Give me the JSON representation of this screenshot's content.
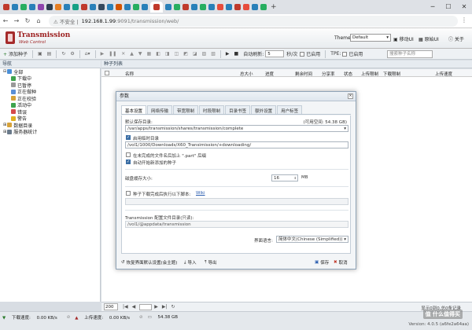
{
  "browser": {
    "warning": "不安全",
    "url_host": "192.168.1.99",
    "url_path": ":9091/transmission/web/"
  },
  "app": {
    "title": "Transmission",
    "subtitle": "Web Control",
    "theme_label": "Theme",
    "theme_value": "Default",
    "mobile_ui": "移动UI",
    "original_ui": "原始UI",
    "about": "关于"
  },
  "toolbar": {
    "add_torrent": "添加种子",
    "speed_limit_label": "自动刷新:",
    "speed_value": "5",
    "seconds": "秒/次",
    "enabled1": "已启用",
    "tpe": "TPE:",
    "enabled2": "已启用",
    "search_placeholder": "搜索种子名称"
  },
  "sidebar": {
    "title": "导航",
    "items": [
      {
        "label": "全部",
        "color": "#4a8fd6",
        "indent": 4
      },
      {
        "label": "下载中",
        "color": "#3fa34d",
        "indent": 12
      },
      {
        "label": "已暂停",
        "color": "#999999",
        "indent": 12
      },
      {
        "label": "正在做种",
        "color": "#5a8fd6",
        "indent": 12
      },
      {
        "label": "正在校验",
        "color": "#d6a23a",
        "indent": 12
      },
      {
        "label": "活动中",
        "color": "#3fa34d",
        "indent": 12
      },
      {
        "label": "错误",
        "color": "#d64a4a",
        "indent": 12
      },
      {
        "label": "警告",
        "color": "#e0b020",
        "indent": 12
      },
      {
        "label": "数据目录",
        "color": "#d6a23a",
        "indent": 4
      },
      {
        "label": "服务器统计",
        "color": "#6a7a8a",
        "indent": 4
      }
    ]
  },
  "main": {
    "title": "种子列表",
    "columns": [
      "名称",
      "总大小",
      "进度",
      "剩余时间",
      "分享率",
      "状态",
      "上传限制",
      "下载限制",
      "上传速度"
    ]
  },
  "pager": {
    "per_page": "200",
    "page_info": "显示0到0,总0条记录"
  },
  "status": {
    "download_speed_label": "下载速度:",
    "download_speed": "0.00 KB/s",
    "upload_speed_label": "上传速度:",
    "upload_speed": "0.00 KB/s",
    "free": "54.38 GB",
    "version": "Version: 4.0.5 (a6fe2a64aa)",
    "watermark": "值 什么值得买"
  },
  "modal": {
    "title": "参数",
    "tabs": [
      "基本设置",
      "网络传输",
      "带宽限制",
      "时段限制",
      "目录书签",
      "额外设置",
      "用户标签"
    ],
    "save_dir_label": "默认保存目录:",
    "available": "(可用空间: 54.38 GB)",
    "save_dir": "/var/apps/transmission/shares/transmission/complete",
    "incomplete_label": "启用临时目录",
    "incomplete_dir": "/vol1/1000/Downloads/X60_Transimission/+downloading/",
    "part_label": "在未完成的文件名后加上 \".part\" 后缀",
    "autostart_label": "自动开始新添加的种子",
    "cache_label": "磁盘缓存大小:",
    "cache_value": "16",
    "cache_unit": "MB",
    "script_label": "种子下载完成后执行以下脚本:",
    "wiki": "Wiki",
    "config_label": "Transmission 配置文件目录(只读):",
    "config_dir": "/vol1/@appdata/transmission",
    "lang_label": "界面语言:",
    "lang_value": "简体中文(Chinese (Simplified))",
    "restore": "恢复界面默认设置(会主题)",
    "import": "导入",
    "export": "导出",
    "save": "保存",
    "cancel": "取消"
  }
}
